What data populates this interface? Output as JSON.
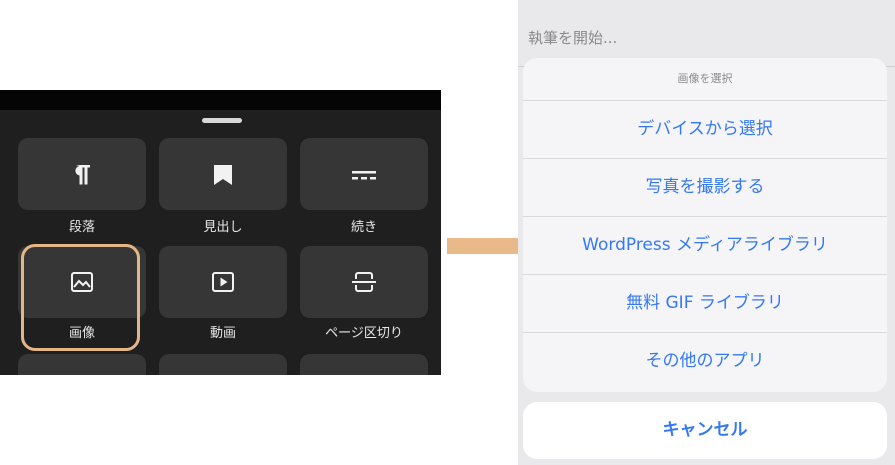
{
  "inserter": {
    "blocks": [
      {
        "label": "段落",
        "icon": "paragraph-icon"
      },
      {
        "label": "見出し",
        "icon": "bookmark-icon"
      },
      {
        "label": "続き",
        "icon": "more-icon"
      },
      {
        "label": "画像",
        "icon": "image-icon",
        "highlighted": true
      },
      {
        "label": "動画",
        "icon": "video-icon"
      },
      {
        "label": "ページ区切り",
        "icon": "page-break-icon"
      }
    ]
  },
  "editor": {
    "placeholder": "執筆を開始..."
  },
  "action_sheet": {
    "title": "画像を選択",
    "options": [
      "デバイスから選択",
      "写真を撮影する",
      "WordPress メディアライブラリ",
      "無料 GIF ライブラリ",
      "その他のアプリ"
    ],
    "cancel_label": "キャンセル"
  },
  "colors": {
    "panel_bg": "#1f1f1f",
    "tile_bg": "#363636",
    "highlight": "#e4b685",
    "arrow": "#eab98a",
    "ios_blue": "#3478f6"
  }
}
